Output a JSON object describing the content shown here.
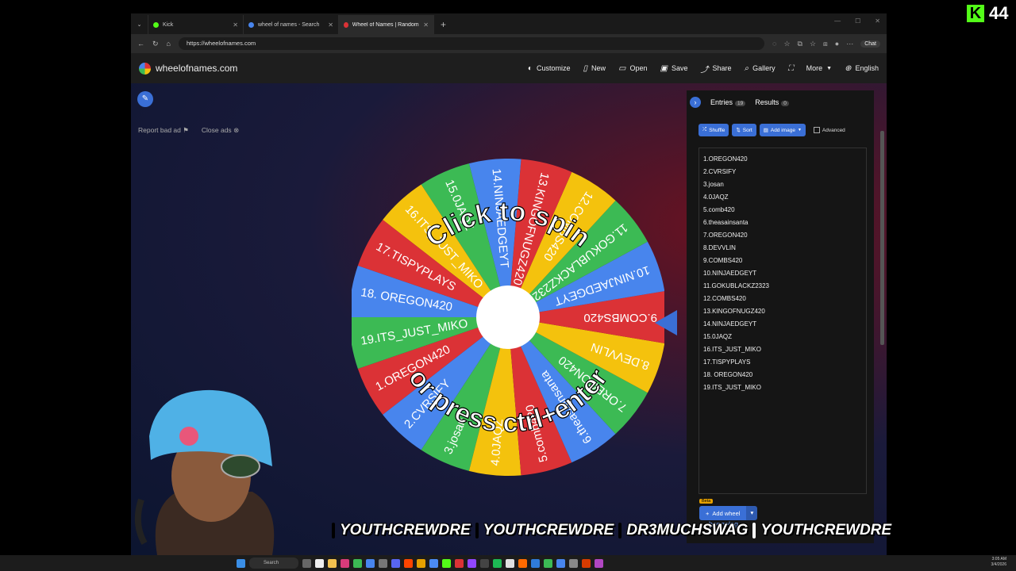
{
  "stream_badge": {
    "value": "44"
  },
  "browser": {
    "tabs": [
      {
        "label": "Kick",
        "color": "#53fc18"
      },
      {
        "label": "wheel of names - Search",
        "color": "#4885ed"
      },
      {
        "label": "Wheel of Names | Random name",
        "color": "#db3236"
      }
    ],
    "url": "https://wheelofnames.com",
    "copilot_label": "Chat"
  },
  "site": {
    "logo_text": "wheelofnames.com",
    "menu": [
      {
        "label": "Customize",
        "icon": "palette-icon"
      },
      {
        "label": "New",
        "icon": "file-icon"
      },
      {
        "label": "Open",
        "icon": "folder-icon"
      },
      {
        "label": "Save",
        "icon": "save-icon"
      },
      {
        "label": "Share",
        "icon": "share-icon"
      },
      {
        "label": "Gallery",
        "icon": "search-icon"
      },
      {
        "label": "",
        "icon": "fullscreen-icon"
      },
      {
        "label": "More",
        "icon": "chevron-down-icon"
      },
      {
        "label": "English",
        "icon": "globe-icon"
      }
    ],
    "ad_links": {
      "report": "Report bad ad",
      "close": "Close ads"
    }
  },
  "wheel": {
    "center_text_top": "Click to spin",
    "center_text_bottom": "or press ctrl+enter",
    "colors": [
      "#db3236",
      "#4885ed",
      "#3cba54",
      "#f4c20d"
    ],
    "segments": [
      "1.OREGON420",
      "2.CVRSIFY",
      "3.josan",
      "4.0JAQZ",
      "5.comb420",
      "6.theasainsanta",
      "7.OREGON420",
      "8.DEVVLIN",
      "9.COMBS420",
      "10.NINJAEDGEYT",
      "11.GOKUBLACKZ2323",
      "12.COMBS420",
      "13.KINGOFNUGZ420",
      "14.NINJAEDGEYT",
      "15.0JAQZ",
      "16.ITS_JUST_MIKO",
      "17.TISPYPLAYS",
      "18. OREGON420",
      "19.ITS_JUST_MIKO"
    ]
  },
  "panel": {
    "entries_tab": "Entries",
    "entries_count": "19",
    "results_tab": "Results",
    "results_count": "0",
    "shuffle": "Shuffle",
    "sort": "Sort",
    "add_image": "Add image",
    "advanced": "Advanced",
    "entries": [
      "1.OREGON420",
      "2.CVRSIFY",
      "3.josan",
      "4.0JAQZ",
      "5.comb420",
      "6.theasainsanta",
      "7.OREGON420",
      "8.DEVVLIN",
      "9.COMBS420",
      "10.NINJAEDGEYT",
      "11.GOKUBLACKZ2323",
      "12.COMBS420",
      "13.KINGOFNUGZ420",
      "14.NINJAEDGEYT",
      "15.0JAQZ",
      "16.ITS_JUST_MIKO",
      "17.TISPYPLAYS",
      "18. OREGON420",
      "19.ITS_JUST_MIKO"
    ],
    "beta": "Beta",
    "add_wheel": "Add wheel",
    "changelog": "hangelog"
  },
  "overlay": {
    "handles": [
      {
        "text": "YOUTHCREWDRE",
        "icon": "instagram-icon",
        "color": "#e1306c"
      },
      {
        "text": "YOUTHCREWDRE",
        "icon": "kick-icon",
        "color": "#53fc18"
      },
      {
        "text": "DR3MUCHSWAG",
        "icon": "snapchat-icon",
        "color": "#fffc00"
      },
      {
        "text": "YOUTHCREWDRE",
        "icon": "tiktok-icon",
        "color": "#111111"
      }
    ]
  },
  "taskbar": {
    "search": "Search",
    "time": "3:05 AM",
    "date": "3/4/2026"
  }
}
